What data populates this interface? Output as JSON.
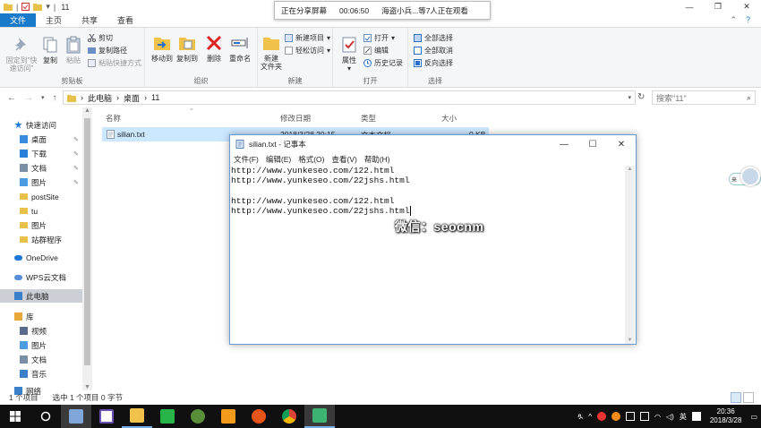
{
  "explorer": {
    "title_path": "11",
    "tabs": [
      {
        "label": "文件",
        "active": true
      },
      {
        "label": "主页",
        "active": false
      },
      {
        "label": "共享",
        "active": false
      },
      {
        "label": "查看",
        "active": false
      }
    ],
    "ribbon": {
      "clipboard": {
        "group_label": "剪贴板",
        "pin_label_1": "固定到\"快",
        "pin_label_2": "速访问\"",
        "copy_label": "复制",
        "paste_label": "粘贴",
        "cut_label": "剪切",
        "copy_path_label": "复制路径",
        "paste_shortcut_label": "粘贴快捷方式"
      },
      "organize": {
        "group_label": "组织",
        "move_to_label": "移动到",
        "copy_to_label": "复制到",
        "delete_label": "删除",
        "rename_label": "重命名"
      },
      "new": {
        "group_label": "新建",
        "new_folder_label_1": "新建",
        "new_folder_label_2": "文件夹",
        "new_item_label": "新建项目",
        "easy_access_label": "轻松访问"
      },
      "open": {
        "group_label": "打开",
        "properties_label": "属性",
        "open_label": "打开",
        "edit_label": "编辑",
        "history_label": "历史记录"
      },
      "select": {
        "group_label": "选择",
        "select_all_label": "全部选择",
        "select_none_label": "全部取消",
        "invert_label": "反向选择"
      }
    },
    "address": {
      "crumbs": [
        "此电脑",
        "桌面",
        "11"
      ],
      "search_placeholder": "搜索\"11\""
    },
    "nav": {
      "items": [
        {
          "label": "快速访问",
          "pinned": false,
          "icon": "star-icon",
          "color": "#1e7ad6"
        },
        {
          "label": "桌面",
          "pinned": true,
          "icon": "desktop-icon",
          "color": "#3a8be0"
        },
        {
          "label": "下载",
          "pinned": true,
          "icon": "download-icon",
          "color": "#2a7fd8"
        },
        {
          "label": "文档",
          "pinned": true,
          "icon": "document-icon",
          "color": "#7a8ea6"
        },
        {
          "label": "图片",
          "pinned": true,
          "icon": "picture-icon",
          "color": "#4d9be0"
        },
        {
          "label": "postSite",
          "pinned": false,
          "icon": "folder-icon",
          "color": "#e8c14a"
        },
        {
          "label": "tu",
          "pinned": false,
          "icon": "folder-icon",
          "color": "#e8c14a"
        },
        {
          "label": "图片",
          "pinned": false,
          "icon": "folder-icon",
          "color": "#e8c14a"
        },
        {
          "label": "站群程序",
          "pinned": false,
          "icon": "folder-icon",
          "color": "#e8c14a"
        },
        {
          "label": "OneDrive",
          "pinned": false,
          "icon": "cloud-icon",
          "color": "#1e7ad6"
        },
        {
          "label": "WPS云文档",
          "pinned": false,
          "icon": "cloud-icon",
          "color": "#5a8fd8"
        },
        {
          "label": "此电脑",
          "pinned": false,
          "icon": "computer-icon",
          "color": "#3a7fc8",
          "selected": true
        },
        {
          "label": "库",
          "pinned": false,
          "icon": "library-icon",
          "color": "#e8a83a"
        },
        {
          "label": "视频",
          "pinned": false,
          "icon": "video-icon",
          "color": "#5a6a8a"
        },
        {
          "label": "图片",
          "pinned": false,
          "icon": "picture-icon",
          "color": "#4d9be0"
        },
        {
          "label": "文档",
          "pinned": false,
          "icon": "document-icon",
          "color": "#7a8ea6"
        },
        {
          "label": "音乐",
          "pinned": false,
          "icon": "music-icon",
          "color": "#3a7fc8"
        },
        {
          "label": "网络",
          "pinned": false,
          "icon": "network-icon",
          "color": "#3a7fc8"
        }
      ]
    },
    "columns": {
      "name": "名称",
      "date": "修改日期",
      "type": "类型",
      "size": "大小"
    },
    "files": [
      {
        "name": "silian.txt",
        "date": "2018/3/28 20:15",
        "type": "文本文档",
        "size": "0 KB"
      }
    ],
    "status": {
      "count": "1 个项目",
      "selected": "选中 1 个项目  0 字节"
    }
  },
  "share_banner": {
    "label": "正在分享屏幕",
    "time": "00:06:50",
    "viewers": "海盗小兵...等7人正在观看"
  },
  "notepad": {
    "title": "silian.txt - 记事本",
    "menu": [
      "文件(F)",
      "编辑(E)",
      "格式(O)",
      "查看(V)",
      "帮助(H)"
    ],
    "lines": [
      "http://www.yunkeseo.com/122.html",
      "http://www.yunkeseo.com/22jshs.html",
      "",
      "http://www.yunkeseo.com/122.html",
      "http://www.yunkeseo.com/22jshs.html"
    ]
  },
  "watermark": "微信：seocnm",
  "float_widget_label": "来",
  "taskbar": {
    "tray_ime": "英",
    "time": "20:36",
    "date": "2018/3/28"
  }
}
